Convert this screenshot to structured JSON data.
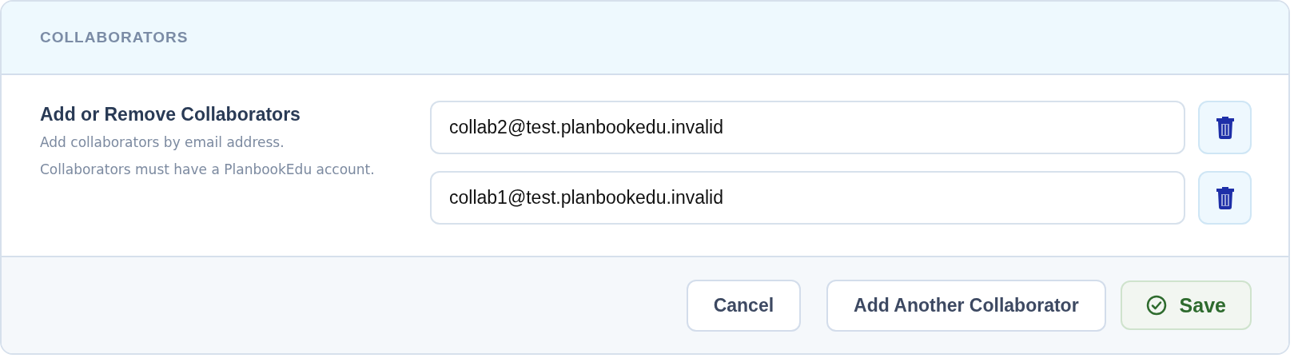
{
  "section": {
    "title": "COLLABORATORS"
  },
  "field": {
    "label": "Add or Remove Collaborators",
    "help": "Add collaborators by email address. Collaborators must have a PlanbookEdu account."
  },
  "collaborators": [
    {
      "email": "collab2@test.planbookedu.invalid"
    },
    {
      "email": "collab1@test.planbookedu.invalid"
    }
  ],
  "buttons": [
    {
      "label": "Cancel",
      "kind": "plain"
    },
    {
      "label": "Add Another Collaborator",
      "kind": "plain"
    },
    {
      "label": "Save",
      "kind": "primary"
    }
  ]
}
